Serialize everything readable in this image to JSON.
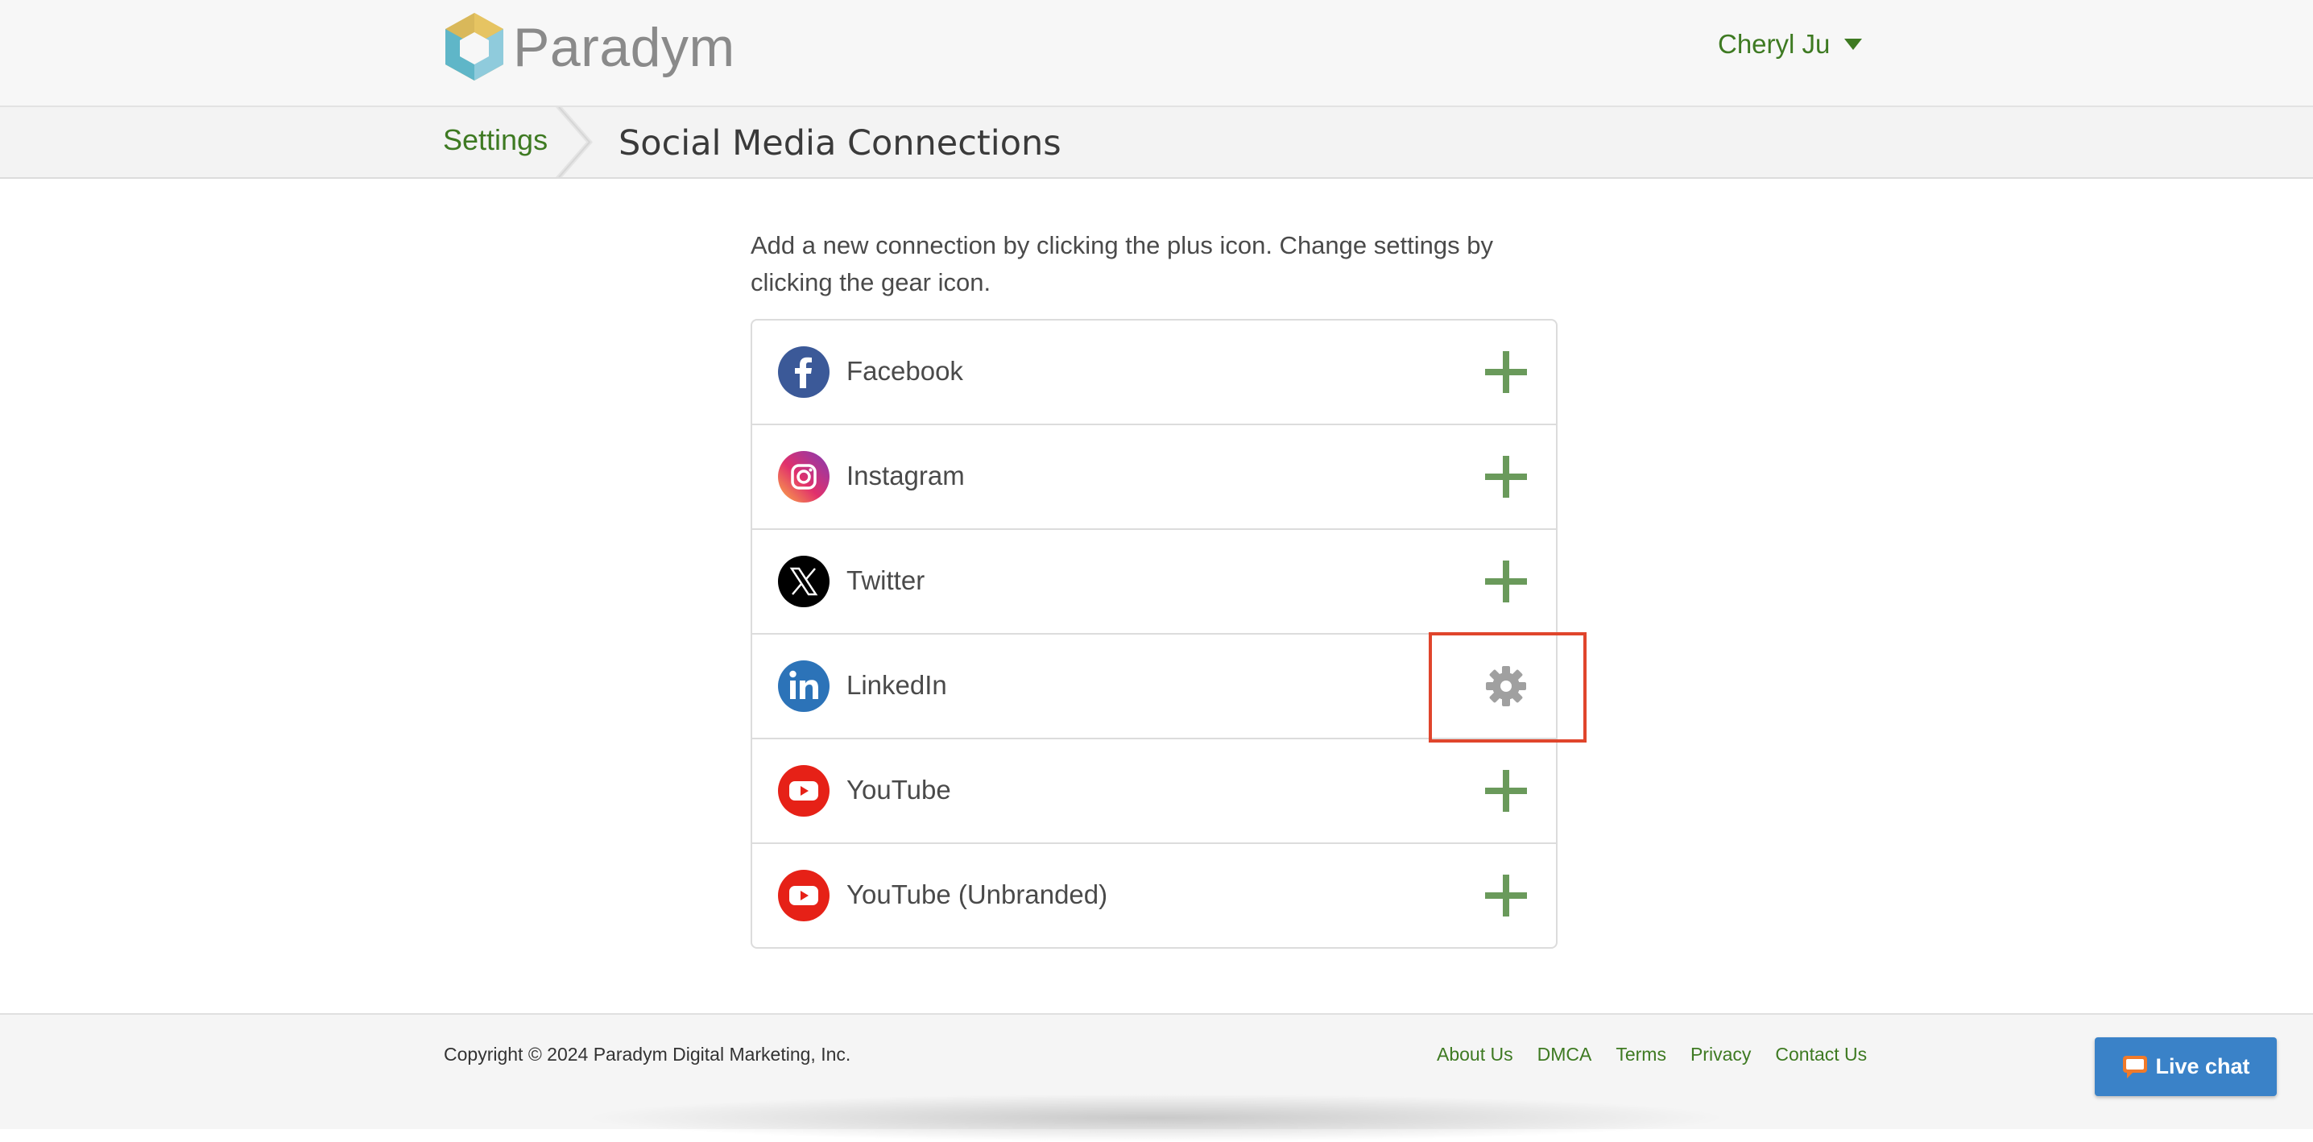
{
  "header": {
    "logo_text": "Paradym",
    "user_name": "Cheryl Ju"
  },
  "breadcrumb": {
    "parent": "Settings",
    "title": "Social Media Connections"
  },
  "intro_text": "Add a new connection by clicking the plus icon. Change settings by clicking the gear icon.",
  "connections": [
    {
      "label": "Facebook",
      "icon": "facebook-icon",
      "action": "plus-icon"
    },
    {
      "label": "Instagram",
      "icon": "instagram-icon",
      "action": "plus-icon"
    },
    {
      "label": "Twitter",
      "icon": "twitter-x-icon",
      "action": "plus-icon"
    },
    {
      "label": "LinkedIn",
      "icon": "linkedin-icon",
      "action": "gear-icon"
    },
    {
      "label": "YouTube",
      "icon": "youtube-icon",
      "action": "plus-icon"
    },
    {
      "label": "YouTube (Unbranded)",
      "icon": "youtube-icon",
      "action": "plus-icon"
    }
  ],
  "footer": {
    "copyright": "Copyright © 2024 Paradym Digital Marketing, Inc.",
    "links": [
      "About Us",
      "DMCA",
      "Terms",
      "Privacy",
      "Contact Us"
    ]
  },
  "live_chat": {
    "label": "Live chat"
  },
  "colors": {
    "brand_green": "#3e7a22",
    "plus_green": "#6a9a5b",
    "gear_gray": "#a0a0a0",
    "highlight_red": "#e0452c",
    "live_chat_blue": "#3a82c8"
  }
}
